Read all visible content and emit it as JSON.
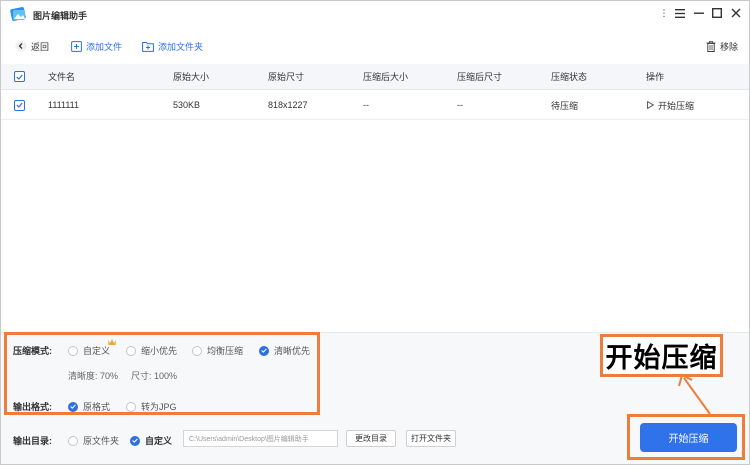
{
  "app": {
    "title": "图片编辑助手"
  },
  "toolbar": {
    "back": "返回",
    "add_file": "添加文件",
    "add_folder": "添加文件夹",
    "remove": "移除"
  },
  "table": {
    "columns": [
      "文件名",
      "原始大小",
      "原始尺寸",
      "压缩后大小",
      "压缩后尺寸",
      "压缩状态",
      "操作"
    ],
    "rows": [
      {
        "name": "1111111",
        "orig_size": "530KB",
        "orig_dim": "818x1227",
        "new_size": "--",
        "new_dim": "--",
        "status": "待压缩",
        "action": "开始压缩"
      }
    ]
  },
  "settings": {
    "mode_label": "压缩模式:",
    "modes": [
      "自定义",
      "缩小优先",
      "均衡压缩",
      "清晰优先"
    ],
    "selected_mode": "清晰优先",
    "clarity": "清晰度:  70%",
    "size": "尺寸:  100%",
    "format_label": "输出格式:",
    "formats": [
      "原格式",
      "转为JPG"
    ],
    "selected_format": "原格式",
    "dir_label": "输出目录:",
    "dirs": [
      "原文件夹",
      "自定义"
    ],
    "selected_dir": "自定义",
    "path_value": "C:\\Users\\admin\\Desktop\\图片编辑助手",
    "change_dir": "更改目录",
    "open_folder": "打开文件夹"
  },
  "start_button": "开始压缩",
  "callout": "开始压缩",
  "colors": {
    "accent": "#2f72ea",
    "highlight": "#ee7d3b"
  }
}
